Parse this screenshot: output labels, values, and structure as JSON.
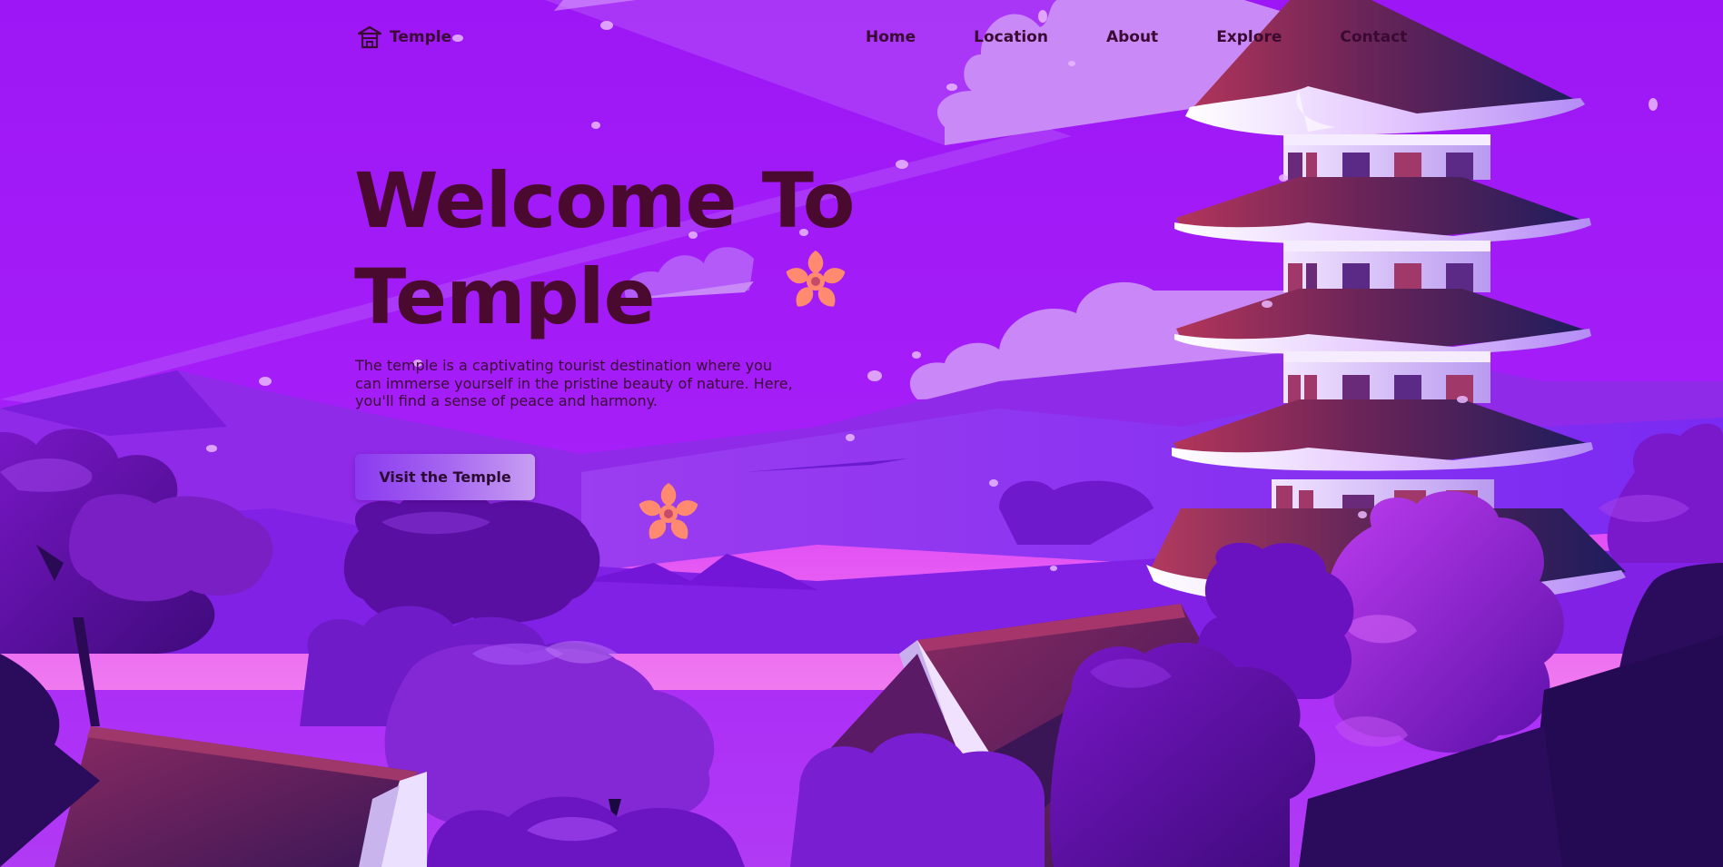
{
  "brand": {
    "name": "Temple",
    "icon": "temple-icon"
  },
  "nav": {
    "items": [
      {
        "label": "Home"
      },
      {
        "label": "Location"
      },
      {
        "label": "About"
      },
      {
        "label": "Explore"
      },
      {
        "label": "Contact"
      }
    ]
  },
  "hero": {
    "title_line1": "Welcome To",
    "title_line2": "Temple",
    "description": "The temple is a captivating tourist destination where you can immerse yourself in the pristine beauty of nature. Here, you'll find a sense of peace and harmony.",
    "cta_label": "Visit the Temple"
  },
  "colors": {
    "sky": "#a11cf7",
    "text_dark": "#3a0a33",
    "title": "#4a0a30",
    "flower": "#ff8a70",
    "roof_red": "#a8304f",
    "roof_navy": "#1e1f5e"
  }
}
